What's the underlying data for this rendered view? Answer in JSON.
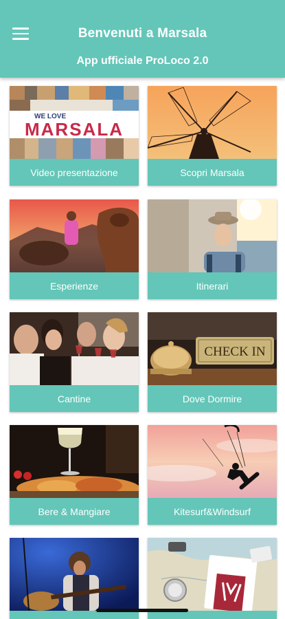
{
  "header": {
    "title": "Benvenuti a Marsala",
    "subtitle": "App ufficiale ProLoco 2.0"
  },
  "tiles": [
    {
      "label": "Video presentazione",
      "image": "we-love-marsala-collage"
    },
    {
      "label": "Scopri Marsala",
      "image": "windmill-sunset"
    },
    {
      "label": "Esperienze",
      "image": "horse-riding-sunset"
    },
    {
      "label": "Itinerari",
      "image": "traveler-street"
    },
    {
      "label": "Cantine",
      "image": "wine-tasting-friends"
    },
    {
      "label": "Dove Dormire",
      "image": "check-in-bell"
    },
    {
      "label": "Bere & Mangiare",
      "image": "wine-and-food"
    },
    {
      "label": "Kitesurf&Windsurf",
      "image": "kitesurfer-silhouette"
    },
    {
      "label": "",
      "image": "guitar-performer"
    },
    {
      "label": "",
      "image": "map-travel-items"
    }
  ],
  "collage": {
    "line1": "WE LOVE",
    "line2": "MARSALA"
  },
  "sign": {
    "text": "CHECK IN"
  },
  "colors": {
    "primary": "#63c6b8",
    "text_on_primary": "#ffffff"
  }
}
